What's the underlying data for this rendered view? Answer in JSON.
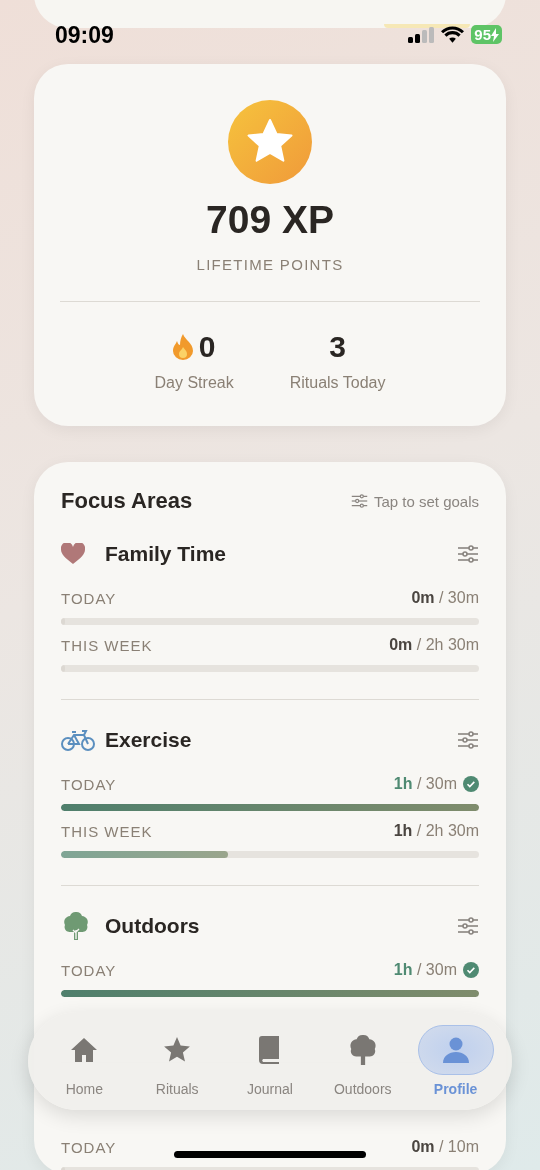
{
  "status_bar": {
    "time": "09:09",
    "battery": "95"
  },
  "xp_card": {
    "points": "709 XP",
    "caption": "LIFETIME POINTS",
    "stats": [
      {
        "value": "0",
        "label": "Day Streak"
      },
      {
        "value": "3",
        "label": "Rituals Today"
      }
    ]
  },
  "focus_areas": {
    "title": "Focus Areas",
    "hint": "Tap to set goals",
    "areas": [
      {
        "name": "Family Time",
        "color": "#b07878",
        "rows": [
          {
            "label": "TODAY",
            "done": "0m",
            "goal": "/ 30m",
            "level": 0,
            "goal_met": false
          },
          {
            "label": "THIS WEEK",
            "done": "0m",
            "goal": "/ 2h 30m",
            "level": 0,
            "goal_met": false
          }
        ]
      },
      {
        "name": "Exercise",
        "color": "#5b8fbf",
        "rows": [
          {
            "label": "TODAY",
            "done": "1h",
            "goal": "/ 30m",
            "level": 1,
            "goal_met": true
          },
          {
            "label": "THIS WEEK",
            "done": "1h",
            "goal": "/ 2h 30m",
            "level": 0.4,
            "goal_met": false
          }
        ]
      },
      {
        "name": "Outdoors",
        "color": "#6f9a73",
        "rows": [
          {
            "label": "TODAY",
            "done": "1h",
            "goal": "/ 30m",
            "level": 1,
            "goal_met": true
          }
        ]
      },
      {
        "rows": [
          {
            "label": "TODAY",
            "done": "0m",
            "goal": "/ 10m",
            "level": 0,
            "goal_met": false
          }
        ]
      }
    ]
  },
  "tab_bar": [
    {
      "label": "Home",
      "selected": false
    },
    {
      "label": "Rituals",
      "selected": false
    },
    {
      "label": "Journal",
      "selected": false
    },
    {
      "label": "Outdoors",
      "selected": false
    },
    {
      "label": "Profile",
      "selected": true
    }
  ]
}
